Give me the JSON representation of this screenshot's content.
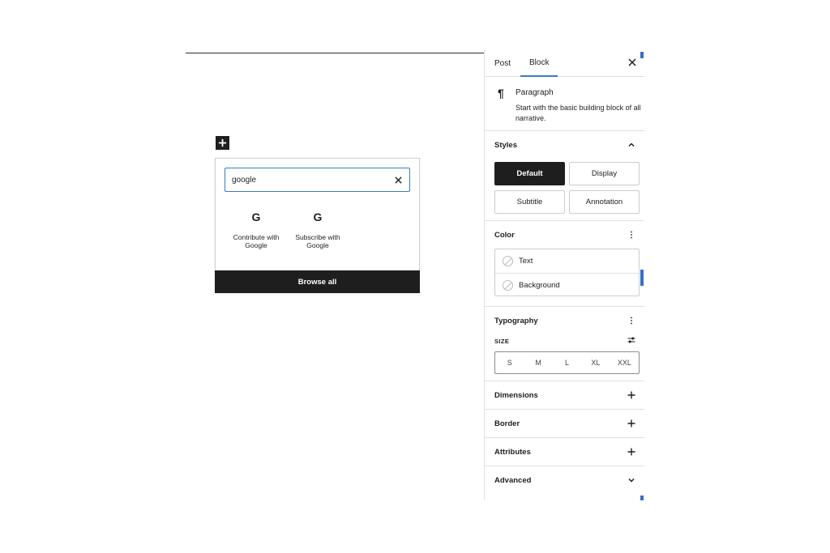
{
  "inserter": {
    "search_value": "google",
    "results": [
      {
        "icon": "G",
        "label": "Contribute with Google"
      },
      {
        "icon": "G",
        "label": "Subscribe with Google"
      }
    ],
    "browse_all": "Browse all"
  },
  "sidebar": {
    "tabs": [
      "Post",
      "Block"
    ],
    "active_tab": "Block",
    "block": {
      "icon": "¶",
      "title": "Paragraph",
      "description": "Start with the basic building block of all narrative."
    },
    "styles": {
      "title": "Styles",
      "options": [
        "Default",
        "Display",
        "Subtitle",
        "Annotation"
      ],
      "selected": "Default"
    },
    "color": {
      "title": "Color",
      "items": [
        "Text",
        "Background"
      ]
    },
    "typography": {
      "title": "Typography",
      "size_label": "SIZE",
      "sizes": [
        "S",
        "M",
        "L",
        "XL",
        "XXL"
      ]
    },
    "panels": [
      "Dimensions",
      "Border",
      "Attributes",
      "Advanced"
    ]
  },
  "colors": {
    "accent": "#3a7bbf",
    "dark": "#1e1e1e",
    "scroll": "#3a6ec2"
  }
}
